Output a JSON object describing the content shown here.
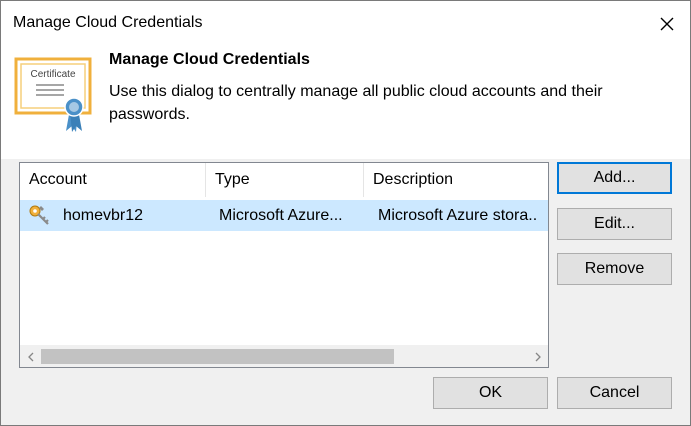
{
  "window": {
    "title": "Manage Cloud Credentials"
  },
  "header": {
    "title": "Manage Cloud Credentials",
    "description": "Use this dialog to centrally manage all public cloud accounts and their passwords.",
    "icon_label": "Certificate"
  },
  "list": {
    "columns": [
      "Account",
      "Type",
      "Description"
    ],
    "rows": [
      {
        "account": "homevbr12",
        "type": "Microsoft Azure...",
        "description": "Microsoft Azure stora..",
        "selected": true
      }
    ]
  },
  "side_buttons": {
    "add": "Add...",
    "edit": "Edit...",
    "remove": "Remove"
  },
  "footer": {
    "ok": "OK",
    "cancel": "Cancel"
  },
  "icons": {
    "close": "close-icon",
    "certificate": "certificate-icon",
    "key": "key-icon",
    "scroll_left": "chevron-left-icon",
    "scroll_right": "chevron-right-icon"
  },
  "colors": {
    "selection": "#cce8ff",
    "default_button_border": "#0078d7",
    "button_face": "#e1e1e1",
    "dialog_bg": "#f0f0f0"
  }
}
